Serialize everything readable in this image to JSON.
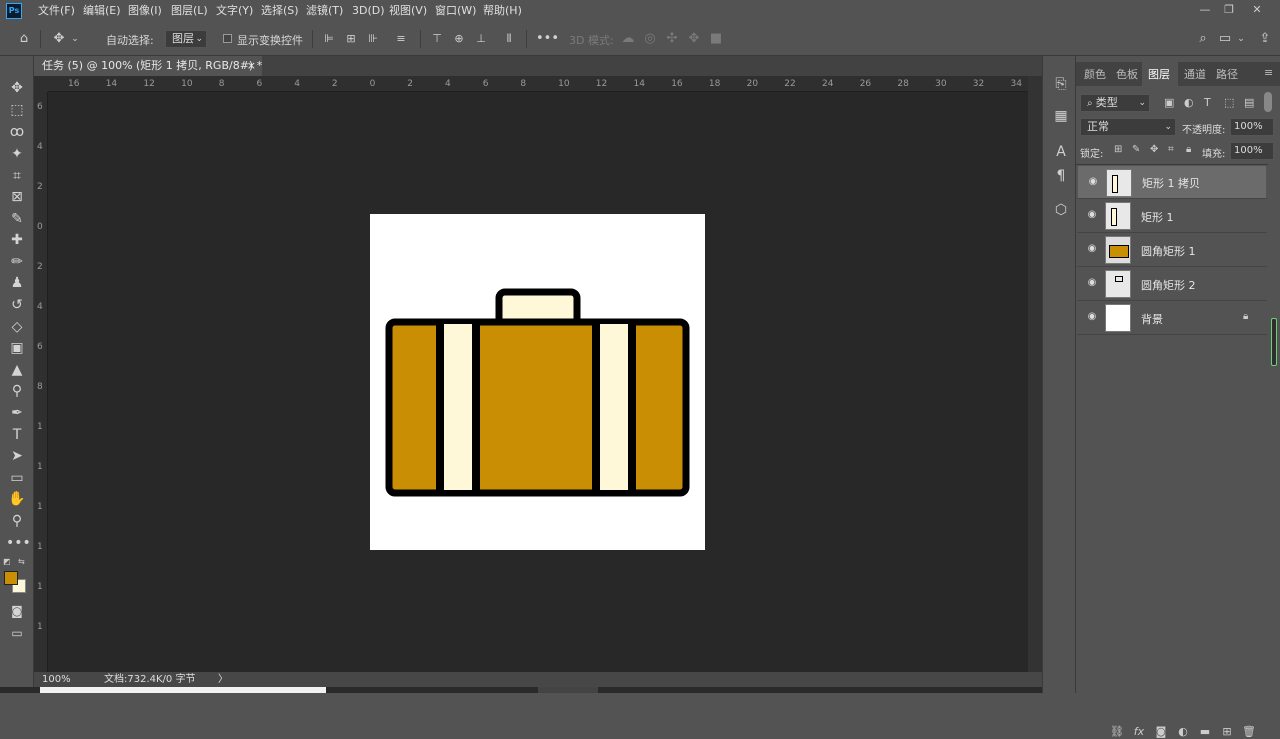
{
  "app": {
    "logo": "Ps"
  },
  "menu": [
    "文件(F)",
    "编辑(E)",
    "图像(I)",
    "图层(L)",
    "文字(Y)",
    "选择(S)",
    "滤镜(T)",
    "3D(D)",
    "视图(V)",
    "窗口(W)",
    "帮助(H)"
  ],
  "options": {
    "auto_select_label": "自动选择:",
    "auto_select_value": "图层",
    "show_transform_label": "显示变换控件",
    "mode_3d_label": "3D 模式:"
  },
  "document_tab": {
    "title": "任务 (5) @ 100% (矩形 1 拷贝, RGB/8#) *",
    "close": "×"
  },
  "ruler_h_ticks": [
    "16",
    "14",
    "12",
    "10",
    "8",
    "6",
    "4",
    "2",
    "0",
    "2",
    "4",
    "6",
    "8",
    "10",
    "12",
    "14",
    "16",
    "18",
    "20",
    "22",
    "24",
    "26",
    "28",
    "30",
    "32",
    "34"
  ],
  "ruler_v_ticks": [
    "6",
    "4",
    "2",
    "0",
    "2",
    "4",
    "6",
    "8",
    "1",
    "1",
    "1",
    "1",
    "1",
    "1"
  ],
  "status": {
    "zoom": "100%",
    "doc": "文档:732.4K/0 字节",
    "arrow": "〉"
  },
  "panel": {
    "tabs": [
      "颜色",
      "色板",
      "图层",
      "通道",
      "路径"
    ],
    "active_tab": "图层",
    "filter_label": "类型",
    "blend_mode": "正常",
    "opacity_label": "不透明度:",
    "opacity_value": "100%",
    "lock_label": "锁定:",
    "fill_label": "填充:",
    "fill_value": "100%"
  },
  "layers": [
    {
      "name": "矩形 1 拷贝",
      "selected": true,
      "thumb": "stripe-copy"
    },
    {
      "name": "矩形 1",
      "selected": false,
      "thumb": "stripe"
    },
    {
      "name": "圆角矩形 1",
      "selected": false,
      "thumb": "body"
    },
    {
      "name": "圆角矩形 2",
      "selected": false,
      "thumb": "handle"
    },
    {
      "name": "背景",
      "selected": false,
      "thumb": "white",
      "locked": true
    }
  ],
  "colors": {
    "foreground": "#c98e04",
    "background": "#fdf7da",
    "suitcase_body": "#c98e04",
    "suitcase_stripe": "#fff8d8",
    "outline": "#000000"
  },
  "icons": {
    "tools": [
      "move-icon",
      "marquee-icon",
      "lasso-icon",
      "magic-wand-icon",
      "crop-icon",
      "frame-icon",
      "eyedropper-icon",
      "healing-icon",
      "brush-icon",
      "stamp-icon",
      "history-brush-icon",
      "eraser-icon",
      "gradient-icon",
      "blur-icon",
      "dodge-icon",
      "pen-icon",
      "type-icon",
      "path-select-icon",
      "rectangle-icon",
      "hand-icon",
      "zoom-icon",
      "more-icon"
    ]
  }
}
